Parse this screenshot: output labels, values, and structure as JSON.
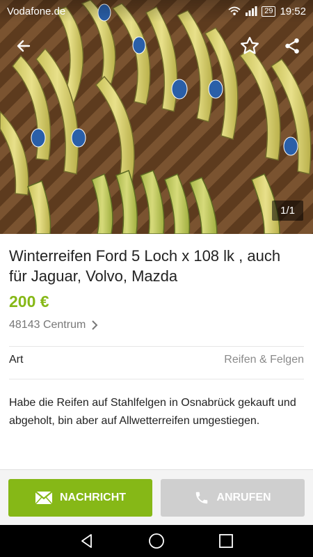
{
  "status_bar": {
    "carrier": "Vodafone.de",
    "battery": "29",
    "time": "19:52"
  },
  "image": {
    "counter": "1/1"
  },
  "listing": {
    "title": "Winterreifen Ford 5 Loch x 108 lk , auch für Jaguar, Volvo, Mazda",
    "price": "200 €",
    "location": "48143 Centrum",
    "attribute": {
      "label": "Art",
      "value": "Reifen & Felgen"
    },
    "description": "Habe die Reifen auf Stahlfelgen in Osnabrück gekauft und abgeholt, bin aber auf Allwetterreifen umgestiegen."
  },
  "actions": {
    "message_label": "NACHRICHT",
    "call_label": "ANRUFEN"
  },
  "colors": {
    "accent": "#86b817",
    "disabled": "#cfcfcf"
  },
  "icons": [
    "back-arrow-icon",
    "star-icon",
    "share-icon",
    "chevron-right-icon",
    "mail-icon",
    "phone-icon",
    "nav-back-icon",
    "nav-home-icon",
    "nav-recent-icon"
  ]
}
